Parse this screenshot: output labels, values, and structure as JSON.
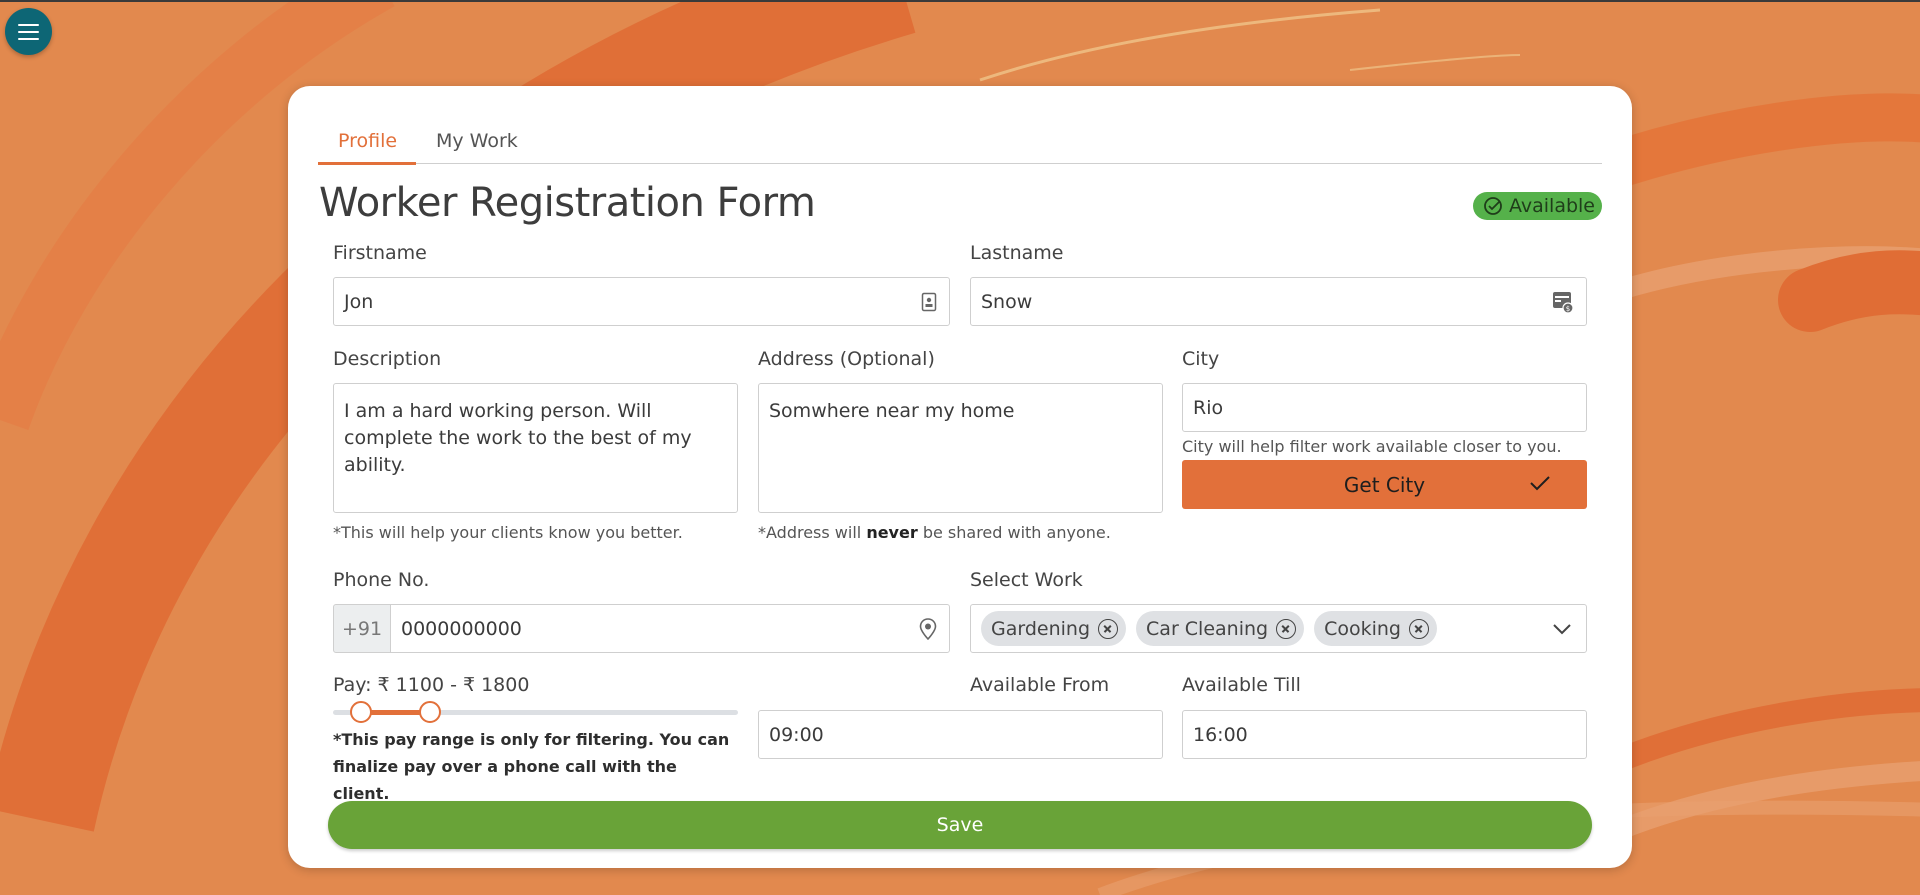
{
  "app": {
    "menu_icon": "hamburger-menu-icon"
  },
  "tabs": [
    {
      "label": "Profile",
      "active": true
    },
    {
      "label": "My Work",
      "active": false
    }
  ],
  "form": {
    "title": "Worker Registration Form",
    "status_badge": {
      "label": "Available",
      "color": "#55b14a",
      "icon": "check-circle-icon"
    },
    "firstname": {
      "label": "Firstname",
      "value": "Jon",
      "icon": "contact-card-icon"
    },
    "lastname": {
      "label": "Lastname",
      "value": "Snow",
      "icon": "id-badge-icon"
    },
    "description": {
      "label": "Description",
      "value": "I am a hard working person. Will complete the work to the best of my ability.",
      "hint": "*This will help your clients know you better."
    },
    "address": {
      "label": "Address (Optional)",
      "value": "Somwhere near my home",
      "hint_prefix": "*Address will ",
      "hint_bold": "never",
      "hint_suffix": " be shared with anyone."
    },
    "city": {
      "label": "City",
      "value": "Rio",
      "hint": "City will help filter work available closer to you.",
      "button_label": "Get City",
      "button_icon": "checkmark-icon"
    },
    "phone": {
      "label": "Phone No.",
      "prefix": "+91",
      "value": "0000000000",
      "icon": "location-pin-icon"
    },
    "work": {
      "label": "Select Work",
      "selected": [
        "Gardening",
        "Car Cleaning",
        "Cooking"
      ],
      "dropdown_icon": "chevron-down-icon"
    },
    "pay": {
      "label": "Pay: ₹ 1100 - ₹ 1800",
      "min": 1100,
      "max": 1800,
      "range_low_fraction": 0.07,
      "range_high_fraction": 0.24,
      "note": "*This pay range is only for filtering. You can finalize pay over a phone call with the client."
    },
    "available_from": {
      "label": "Available From",
      "value": "09:00"
    },
    "available_till": {
      "label": "Available Till",
      "value": "16:00"
    },
    "save_label": "Save"
  },
  "colors": {
    "accent": "#e2703a",
    "save": "#69a338",
    "menu": "#0d6675",
    "background": "#e2894e"
  }
}
